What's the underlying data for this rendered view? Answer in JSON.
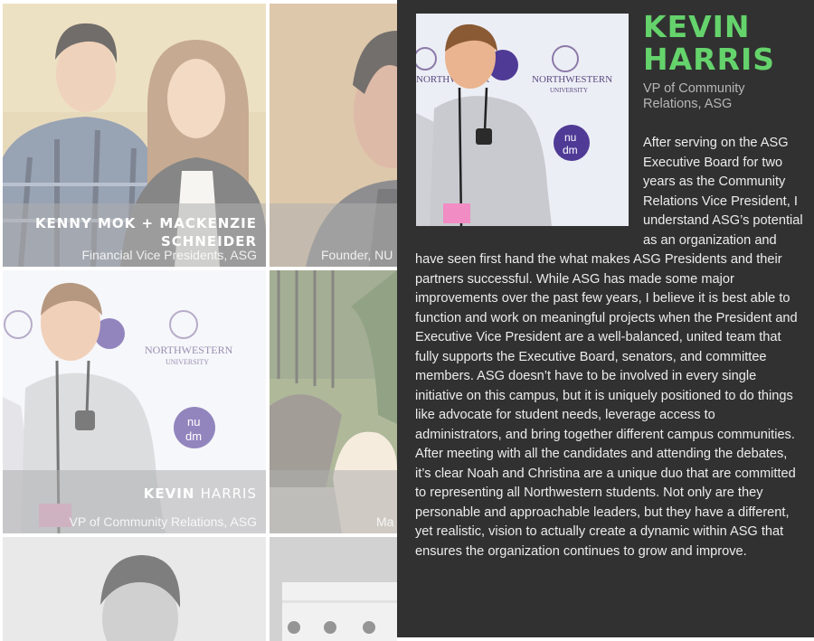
{
  "grid": {
    "tiles": [
      {
        "name_line1": "Kenny Mok + Mackenzie",
        "name_line2": "Schneider",
        "role": "Financial Vice Presidents, ASG"
      },
      {
        "name": "",
        "role": "Founder, NU C"
      },
      {
        "name_bold": "Kevin",
        "name_light": "Harris",
        "role": "VP of Community Relations, ASG"
      },
      {
        "name": "",
        "role": "Ma"
      }
    ]
  },
  "profile": {
    "first_name": "Kevin",
    "last_name": "Harris",
    "role": "VP of Community Relations, ASG",
    "bio": "After serving on the ASG Executive Board for two years as the Community Relations Vice President, I understand ASG’s potential as an organization and have seen first hand the what makes ASG Presidents and their partners successful. While ASG has made some major improvements over the past few years, I believe it is best able to function and work on meaningful projects when the President and Executive Vice President are a well-balanced, united team that fully supports the Executive Board, senators, and committee members. ASG doesn’t have to be involved in every single initiative on this campus, but it is uniquely positioned to do things like advocate for student needs, leverage access to administrators, and bring together different campus communities. After meeting with all the candidates and attending the debates, it’s clear Noah and Christina are a unique duo that are committed to representing all Northwestern students. Not only are they personable and approachable leaders, but they have a different, yet realistic, vision to actually create a dynamic within ASG that ensures the organization continues to grow and improve.",
    "photo_backdrop_text": [
      "NORTHWESTERN",
      "UNIVERSITY",
      "nu",
      "dm"
    ]
  },
  "colors": {
    "panel_bg": "#313131",
    "name_accent": "#65d36c",
    "role_text": "#b6b6b6",
    "bio_text": "#ececec"
  }
}
